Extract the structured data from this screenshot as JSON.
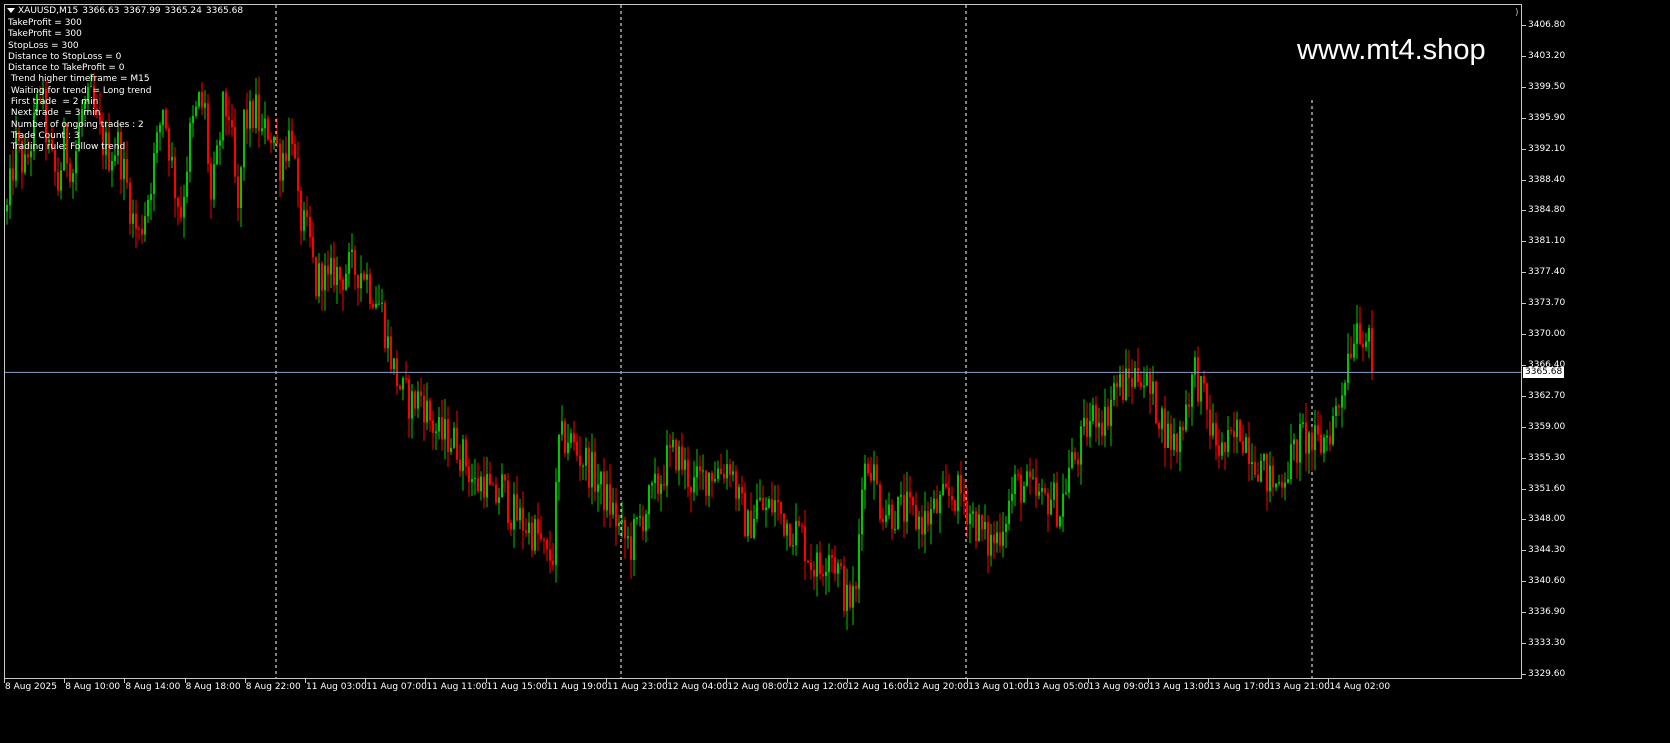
{
  "window": {
    "symbol": "XAUUSD,M15",
    "ohlc": [
      "3366.63",
      "3367.99",
      "3365.24",
      "3365.68"
    ]
  },
  "info_panel": [
    "TakeProfit = 300",
    "TakeProfit = 300",
    "StopLoss = 300",
    "Distance to StopLoss = 0",
    "Distance to TakeProfit = 0",
    " Trend higher timeframe = M15",
    " Waiting for trend  = Long trend",
    " First trade  = 2 min",
    " Next trade  = 3 min",
    " Number of ongoing trades : 2",
    " Trade Count : 3",
    " Trading rule: Follow trend"
  ],
  "watermark": "www.mt4.shop",
  "colors": {
    "background": "#000000",
    "bull": "#00c800",
    "bear": "#ff0000",
    "grid": "#ffffff",
    "price_line": "#8aa0c8"
  },
  "price_axis": {
    "labels": [
      "3406.80",
      "3403.20",
      "3399.50",
      "3395.90",
      "3392.10",
      "3388.40",
      "3384.80",
      "3381.10",
      "3377.40",
      "3373.70",
      "3370.00",
      "3366.40",
      "3362.70",
      "3359.00",
      "3355.30",
      "3351.60",
      "3348.00",
      "3344.30",
      "3340.60",
      "3336.90",
      "3333.30",
      "3329.60"
    ],
    "current_price": "3365.68"
  },
  "time_axis": {
    "labels": [
      "8 Aug 2025",
      "8 Aug 10:00",
      "8 Aug 14:00",
      "8 Aug 18:00",
      "8 Aug 22:00",
      "11 Aug 03:00",
      "11 Aug 07:00",
      "11 Aug 11:00",
      "11 Aug 15:00",
      "11 Aug 19:00",
      "11 Aug 23:00",
      "12 Aug 04:00",
      "12 Aug 08:00",
      "12 Aug 12:00",
      "12 Aug 16:00",
      "12 Aug 20:00",
      "13 Aug 01:00",
      "13 Aug 05:00",
      "13 Aug 09:00",
      "13 Aug 13:00",
      "13 Aug 17:00",
      "13 Aug 21:00",
      "14 Aug 02:00"
    ]
  },
  "chart_data": {
    "type": "candlestick",
    "symbol": "XAUUSD",
    "timeframe": "M15",
    "ylim": [
      3329.6,
      3407.5
    ],
    "current_price": 3365.68,
    "day_separators": [
      "8 Aug 22:00",
      "11 Aug 23:00",
      "13 Aug 01:00",
      "14 Aug 02:00"
    ],
    "path": [
      [
        0,
        3385
      ],
      [
        3,
        3393
      ],
      [
        6,
        3390
      ],
      [
        9,
        3395
      ],
      [
        11,
        3400
      ],
      [
        14,
        3392
      ],
      [
        17,
        3388
      ],
      [
        19,
        3393
      ],
      [
        22,
        3390
      ],
      [
        25,
        3397
      ],
      [
        28,
        3398
      ],
      [
        31,
        3394
      ],
      [
        34,
        3392
      ],
      [
        37,
        3393
      ],
      [
        40,
        3388
      ],
      [
        42,
        3384
      ],
      [
        44,
        3382
      ],
      [
        47,
        3387
      ],
      [
        50,
        3393
      ],
      [
        52,
        3398
      ],
      [
        54,
        3393
      ],
      [
        56,
        3388
      ],
      [
        58,
        3385
      ],
      [
        61,
        3394
      ],
      [
        64,
        3398
      ],
      [
        66,
        3397
      ],
      [
        68,
        3386
      ],
      [
        70,
        3391
      ],
      [
        72,
        3397
      ],
      [
        74,
        3397
      ],
      [
        77,
        3384
      ],
      [
        79,
        3396
      ],
      [
        81,
        3396
      ],
      [
        83,
        3397
      ],
      [
        85,
        3394
      ],
      [
        87,
        3395
      ],
      [
        89,
        3394
      ],
      [
        91,
        3391
      ],
      [
        93,
        3393
      ],
      [
        95,
        3395
      ],
      [
        97,
        3385
      ],
      [
        99,
        3383
      ],
      [
        101,
        3381
      ],
      [
        103,
        3376
      ],
      [
        105,
        3378
      ],
      [
        107,
        3376
      ],
      [
        109,
        3378
      ],
      [
        111,
        3377
      ],
      [
        113,
        3378
      ],
      [
        115,
        3378
      ],
      [
        117,
        3378
      ],
      [
        119,
        3378
      ],
      [
        121,
        3376
      ],
      [
        123,
        3375
      ],
      [
        125,
        3373
      ],
      [
        127,
        3369
      ],
      [
        129,
        3366
      ],
      [
        132,
        3363
      ],
      [
        135,
        3362
      ],
      [
        138,
        3363
      ],
      [
        141,
        3360
      ],
      [
        144,
        3358
      ],
      [
        147,
        3358
      ],
      [
        150,
        3357
      ],
      [
        153,
        3355
      ],
      [
        156,
        3352
      ],
      [
        159,
        3353
      ],
      [
        162,
        3350
      ],
      [
        165,
        3352
      ],
      [
        168,
        3349
      ],
      [
        171,
        3348
      ],
      [
        174,
        3347
      ],
      [
        177,
        3346
      ],
      [
        180,
        3343
      ],
      [
        182,
        3344
      ],
      [
        184,
        3357
      ],
      [
        187,
        3358
      ],
      [
        190,
        3356
      ],
      [
        193,
        3355
      ],
      [
        196,
        3353
      ],
      [
        199,
        3351
      ],
      [
        202,
        3349
      ],
      [
        205,
        3346
      ],
      [
        208,
        3345
      ],
      [
        211,
        3348
      ],
      [
        214,
        3350
      ],
      [
        217,
        3352
      ],
      [
        220,
        3355
      ],
      [
        223,
        3356
      ],
      [
        226,
        3354
      ],
      [
        229,
        3352
      ],
      [
        232,
        3353
      ],
      [
        235,
        3354
      ],
      [
        238,
        3354
      ],
      [
        241,
        3355
      ],
      [
        244,
        3350
      ],
      [
        247,
        3347
      ],
      [
        250,
        3350
      ],
      [
        253,
        3349
      ],
      [
        256,
        3350
      ],
      [
        259,
        3348
      ],
      [
        262,
        3347
      ],
      [
        265,
        3346
      ],
      [
        268,
        3343
      ],
      [
        271,
        3342
      ],
      [
        274,
        3345
      ],
      [
        277,
        3342
      ],
      [
        280,
        3338
      ],
      [
        283,
        3339
      ],
      [
        285,
        3354
      ],
      [
        288,
        3355
      ],
      [
        291,
        3350
      ],
      [
        294,
        3349
      ],
      [
        297,
        3349
      ],
      [
        300,
        3349
      ],
      [
        303,
        3348
      ],
      [
        306,
        3348
      ],
      [
        309,
        3349
      ],
      [
        312,
        3350
      ],
      [
        315,
        3351
      ],
      [
        318,
        3351
      ],
      [
        321,
        3349
      ],
      [
        324,
        3347
      ],
      [
        327,
        3345
      ],
      [
        330,
        3346
      ],
      [
        333,
        3349
      ],
      [
        336,
        3352
      ],
      [
        339,
        3352
      ],
      [
        342,
        3351
      ],
      [
        345,
        3350
      ],
      [
        348,
        3351
      ],
      [
        351,
        3349
      ],
      [
        354,
        3354
      ],
      [
        357,
        3356
      ],
      [
        360,
        3359
      ],
      [
        363,
        3361
      ],
      [
        366,
        3360
      ],
      [
        369,
        3364
      ],
      [
        372,
        3364
      ],
      [
        375,
        3365
      ],
      [
        378,
        3366
      ],
      [
        381,
        3363
      ],
      [
        384,
        3361
      ],
      [
        387,
        3358
      ],
      [
        390,
        3357
      ],
      [
        393,
        3362
      ],
      [
        396,
        3366
      ],
      [
        399,
        3362
      ],
      [
        402,
        3358
      ],
      [
        405,
        3356
      ],
      [
        408,
        3357
      ],
      [
        411,
        3359
      ],
      [
        414,
        3357
      ],
      [
        417,
        3355
      ],
      [
        420,
        3353
      ],
      [
        423,
        3352
      ],
      [
        426,
        3354
      ],
      [
        429,
        3356
      ],
      [
        432,
        3358
      ],
      [
        435,
        3357
      ],
      [
        438,
        3357
      ],
      [
        441,
        3359
      ],
      [
        444,
        3362
      ],
      [
        447,
        3368
      ],
      [
        450,
        3372
      ],
      [
        453,
        3370
      ],
      [
        455,
        3367
      ]
    ]
  }
}
